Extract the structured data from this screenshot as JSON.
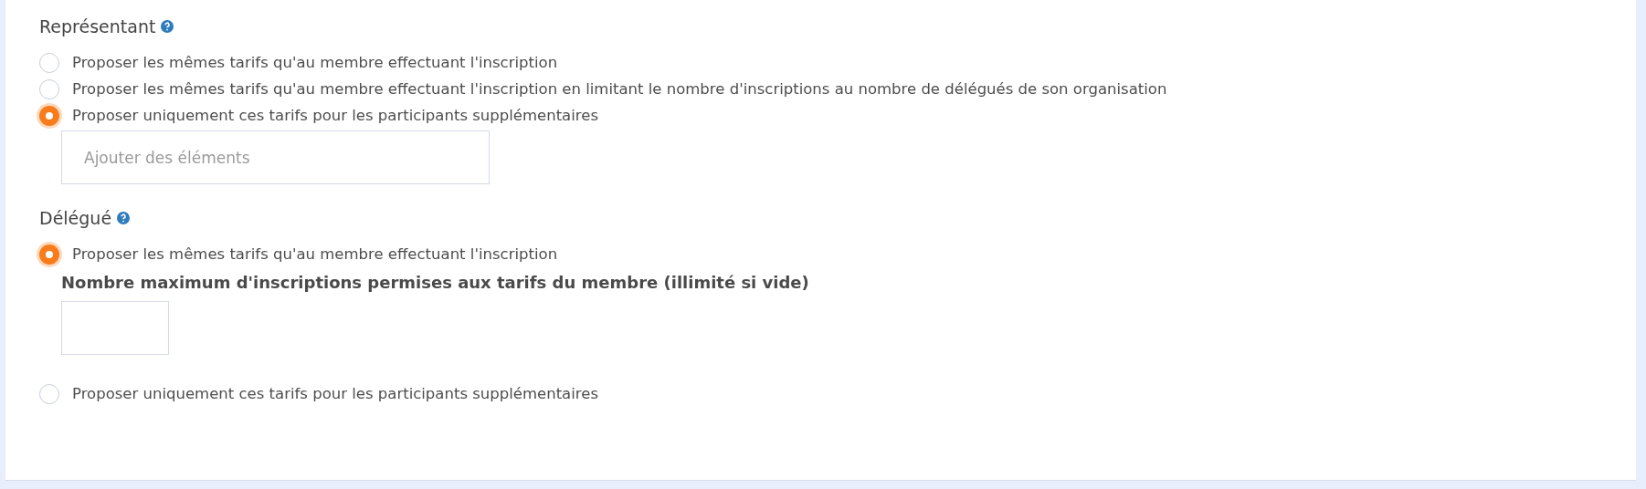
{
  "sections": [
    {
      "title": "Représentant",
      "options": [
        {
          "label": "Proposer les mêmes tarifs qu'au membre effectuant l'inscription",
          "selected": false
        },
        {
          "label": "Proposer les mêmes tarifs qu'au membre effectuant l'inscription en limitant le nombre d'inscriptions au nombre de délégués de son organisation",
          "selected": false
        },
        {
          "label": "Proposer uniquement ces tarifs pour les participants supplémentaires",
          "selected": true,
          "field": {
            "placeholder": "Ajouter des éléments"
          }
        }
      ]
    },
    {
      "title": "Délégué",
      "options": [
        {
          "label": "Proposer les mêmes tarifs qu'au membre effectuant l'inscription",
          "selected": true,
          "limit": {
            "label": "Nombre maximum d'inscriptions permises aux tarifs du membre (illimité si vide)"
          }
        },
        {
          "label": "Proposer uniquement ces tarifs pour les participants supplémentaires",
          "selected": false
        }
      ]
    }
  ]
}
